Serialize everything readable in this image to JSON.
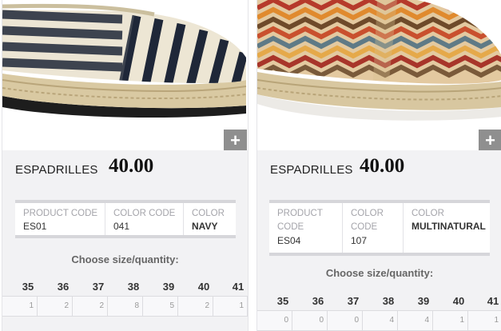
{
  "products": [
    {
      "name": "ESPADRILLES",
      "price": "40.00",
      "code_label": "PRODUCT CODE",
      "code": "ES01",
      "color_code_label": "COLOR CODE",
      "color_code": "041",
      "color_label": "COLOR",
      "color": "NAVY",
      "choose_label": "Choose size/quantity:",
      "sizes": [
        "35",
        "36",
        "37",
        "38",
        "39",
        "40",
        "41"
      ],
      "quantities": [
        "1",
        "2",
        "2",
        "8",
        "5",
        "2",
        "1"
      ],
      "add_icon": "plus-icon"
    },
    {
      "name": "ESPADRILLES",
      "price": "40.00",
      "code_label": "PRODUCT CODE",
      "code": "ES04",
      "color_code_label": "COLOR CODE",
      "color_code": "107",
      "color_label": "COLOR",
      "color": "MULTINATURAL",
      "choose_label": "Choose size/quantity:",
      "sizes": [
        "35",
        "36",
        "37",
        "38",
        "39",
        "40",
        "41"
      ],
      "quantities": [
        "0",
        "0",
        "0",
        "4",
        "4",
        "1",
        "1"
      ],
      "add_icon": "plus-icon"
    }
  ]
}
